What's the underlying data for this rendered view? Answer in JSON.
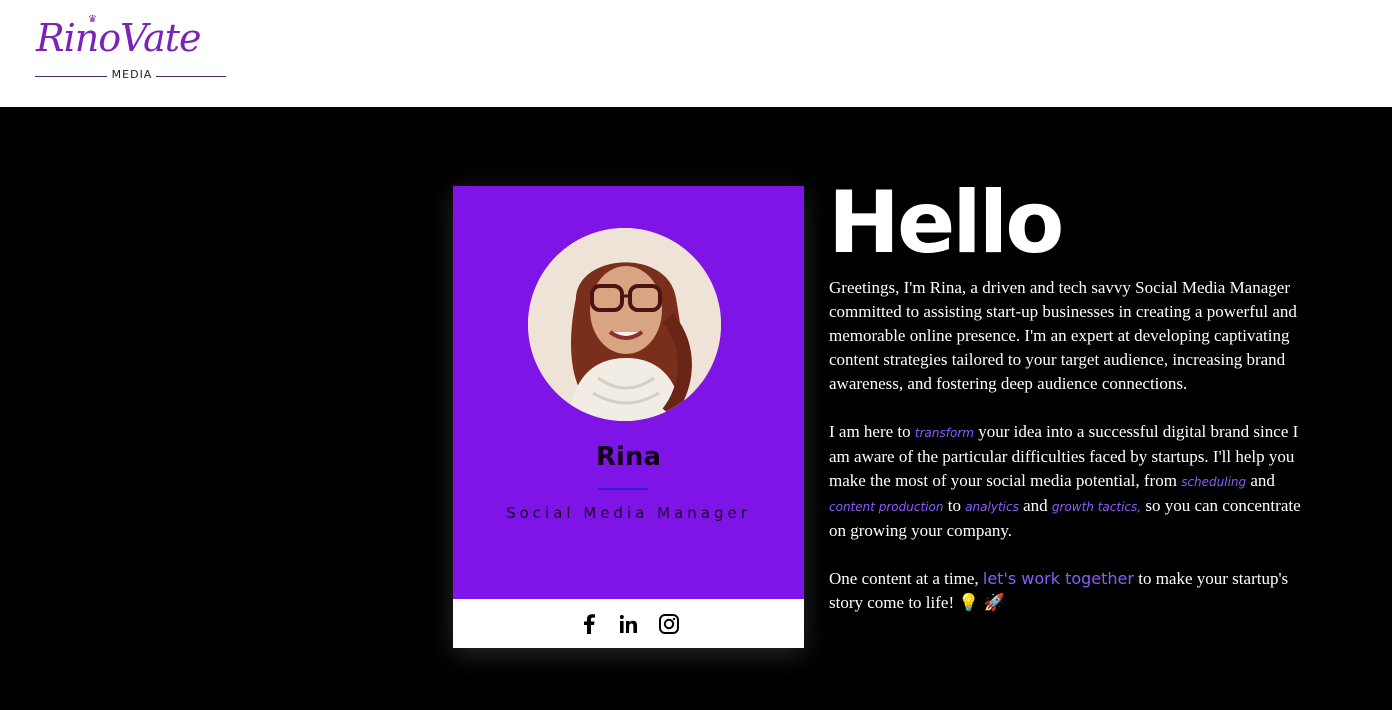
{
  "header": {
    "logo": {
      "script_text": "RinoVate",
      "sub_text": "MEDIA",
      "color": "#7b22b8"
    }
  },
  "card": {
    "name": "Rina",
    "role": "Social Media Manager",
    "accent_color": "#7f14e6",
    "photo_alt": "Rina portrait",
    "social_icons": [
      "facebook-icon",
      "linkedin-icon",
      "instagram-icon"
    ]
  },
  "main": {
    "heading": "Hello",
    "paragraph1": "Greetings, I'm Rina, a driven and tech savvy Social Media Manager committed to assisting start-up businesses in creating a powerful and memorable online presence. I'm an expert at developing captivating content strategies tailored to your target audience, increasing brand awareness, and fostering deep audience connections.",
    "p2": {
      "a": "I am here to ",
      "h1": "transform",
      "b": " your idea into a successful digital brand since I am aware of the particular difficulties faced by startups. I'll help you make the most of your social media potential, from ",
      "h2": "scheduling",
      "c": " and ",
      "h3": "content production",
      "d": " to ",
      "h4": "analytics",
      "e": " and ",
      "h5": "growth tactics,",
      "f": " so you can concentrate on growing your company."
    },
    "p3": {
      "a": "One content at a time, ",
      "cta": "let's work together",
      "b": " to make your startup's story come to life! 💡 🚀"
    },
    "highlight_color": "#8a5cff"
  }
}
